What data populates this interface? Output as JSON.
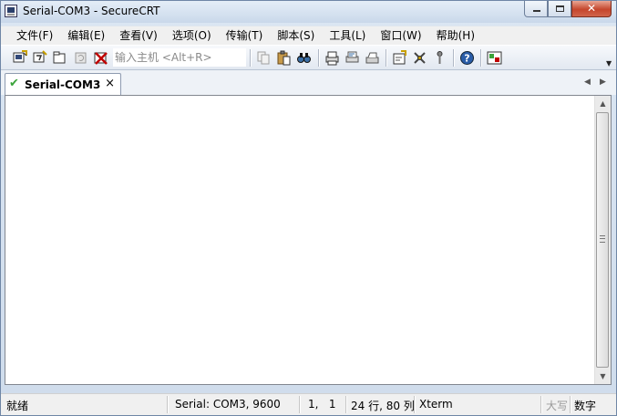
{
  "window": {
    "title": "Serial-COM3 - SecureCRT"
  },
  "menu": [
    "文件(F)",
    "编辑(E)",
    "查看(V)",
    "选项(O)",
    "传输(T)",
    "脚本(S)",
    "工具(L)",
    "窗口(W)",
    "帮助(H)"
  ],
  "toolbar": {
    "quick_connect_placeholder": "输入主机 <Alt+R>",
    "icons": [
      "connect-icon",
      "quick-connect-icon",
      "connect-in-tab-icon",
      "reconnect-icon",
      "disconnect-icon",
      "copy-icon",
      "paste-icon",
      "find-icon",
      "print-icon",
      "print-selection-icon",
      "printer-setup-icon",
      "session-options-icon",
      "global-options-icon",
      "keymap-icon",
      "help-icon",
      "sftp-icon"
    ]
  },
  "tab": {
    "label": "Serial-COM3",
    "close": "×",
    "status": "connected"
  },
  "statusbar": {
    "ready": "就绪",
    "connection": "Serial: COM3, 9600",
    "cursor": "1,   1",
    "size": "24 行, 80 列",
    "terminal_type": "Xterm",
    "caps": "大写",
    "num": "数字"
  },
  "colors": {
    "accent": "#2a5da8",
    "tab_check": "#3aa33a",
    "close_button": "#c5462c"
  }
}
